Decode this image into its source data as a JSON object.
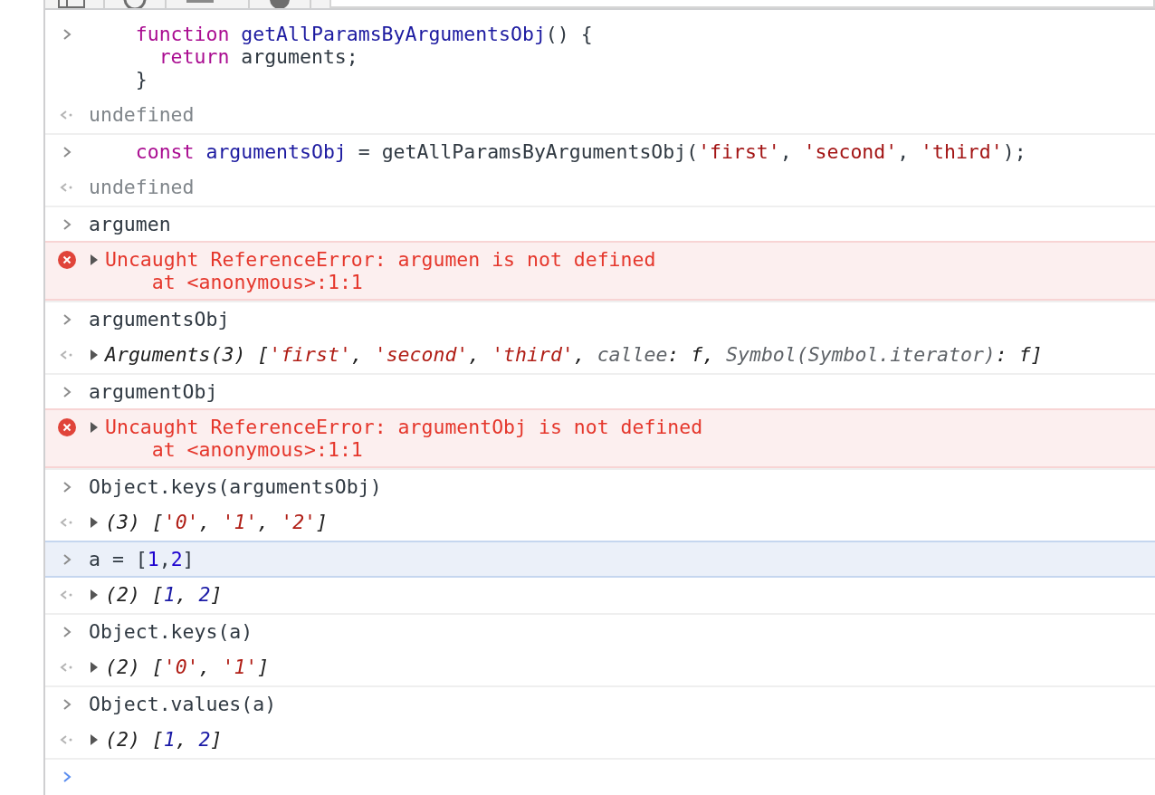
{
  "toolbar": {
    "filter_field": {
      "kind": "field"
    }
  },
  "groups": [
    {
      "messages": [
        {
          "kind": "input",
          "selected": false,
          "lines": [
            [
              {
                "kind": "keyword",
                "t": "    function "
              },
              {
                "kind": "name",
                "t": "getAllParamsByArgumentsObj"
              },
              {
                "kind": "plain",
                "t": "() {"
              }
            ],
            [
              {
                "kind": "keyword",
                "t": "      return "
              },
              {
                "kind": "plain",
                "t": "arguments;"
              }
            ],
            [
              {
                "kind": "plain",
                "t": "    }"
              }
            ]
          ]
        },
        {
          "kind": "output",
          "lines": [
            [
              {
                "kind": "muted",
                "t": "undefined"
              }
            ]
          ]
        }
      ]
    },
    {
      "messages": [
        {
          "kind": "input",
          "selected": false,
          "lines": [
            [
              {
                "kind": "keyword",
                "t": "    const "
              },
              {
                "kind": "name",
                "t": "argumentsObj"
              },
              {
                "kind": "plain",
                "t": " = getAllParamsByArgumentsObj("
              },
              {
                "kind": "string",
                "t": "'first'"
              },
              {
                "kind": "plain",
                "t": ", "
              },
              {
                "kind": "string",
                "t": "'second'"
              },
              {
                "kind": "plain",
                "t": ", "
              },
              {
                "kind": "string",
                "t": "'third'"
              },
              {
                "kind": "plain",
                "t": ");"
              }
            ]
          ]
        },
        {
          "kind": "output",
          "lines": [
            [
              {
                "kind": "muted",
                "t": "undefined"
              }
            ]
          ]
        }
      ]
    },
    {
      "messages": [
        {
          "kind": "input",
          "selected": false,
          "lines": [
            [
              {
                "kind": "plain",
                "t": "argumen"
              }
            ]
          ]
        },
        {
          "kind": "error",
          "expanded": false,
          "lines": [
            [
              {
                "kind": "error",
                "t": "Uncaught ReferenceError: argumen is not defined"
              }
            ],
            [
              {
                "kind": "error",
                "t": "    at <anonymous>:1:1"
              }
            ]
          ]
        }
      ]
    },
    {
      "messages": [
        {
          "kind": "input",
          "selected": false,
          "lines": [
            [
              {
                "kind": "plain",
                "t": "argumentsObj"
              }
            ]
          ]
        },
        {
          "kind": "output",
          "expanded": false,
          "lines": [
            [
              {
                "kind": "italic",
                "t": "Arguments(3) ["
              },
              {
                "kind": "istring",
                "t": "'first'"
              },
              {
                "kind": "italic",
                "t": ", "
              },
              {
                "kind": "istring",
                "t": "'second'"
              },
              {
                "kind": "italic",
                "t": ", "
              },
              {
                "kind": "istring",
                "t": "'third'"
              },
              {
                "kind": "italic",
                "t": ", "
              },
              {
                "kind": "iprop",
                "t": "callee"
              },
              {
                "kind": "italic",
                "t": ": f, "
              },
              {
                "kind": "iprop",
                "t": "Symbol(Symbol.iterator)"
              },
              {
                "kind": "italic",
                "t": ": f]"
              }
            ]
          ]
        }
      ]
    },
    {
      "messages": [
        {
          "kind": "input",
          "selected": false,
          "lines": [
            [
              {
                "kind": "plain",
                "t": "argumentObj"
              }
            ]
          ]
        },
        {
          "kind": "error",
          "expanded": false,
          "lines": [
            [
              {
                "kind": "error",
                "t": "Uncaught ReferenceError: argumentObj is not defined"
              }
            ],
            [
              {
                "kind": "error",
                "t": "    at <anonymous>:1:1"
              }
            ]
          ]
        }
      ]
    },
    {
      "messages": [
        {
          "kind": "input",
          "selected": false,
          "lines": [
            [
              {
                "kind": "plain",
                "t": "Object.keys(argumentsObj)"
              }
            ]
          ]
        },
        {
          "kind": "output",
          "expanded": false,
          "lines": [
            [
              {
                "kind": "italic",
                "t": "(3) ["
              },
              {
                "kind": "istring",
                "t": "'0'"
              },
              {
                "kind": "italic",
                "t": ", "
              },
              {
                "kind": "istring",
                "t": "'1'"
              },
              {
                "kind": "italic",
                "t": ", "
              },
              {
                "kind": "istring",
                "t": "'2'"
              },
              {
                "kind": "italic",
                "t": "]"
              }
            ]
          ]
        }
      ]
    },
    {
      "messages": [
        {
          "kind": "input",
          "selected": true,
          "lines": [
            [
              {
                "kind": "plain",
                "t": "a = ["
              },
              {
                "kind": "number",
                "t": "1"
              },
              {
                "kind": "plain",
                "t": ","
              },
              {
                "kind": "number",
                "t": "2"
              },
              {
                "kind": "plain",
                "t": "]"
              }
            ]
          ]
        },
        {
          "kind": "output",
          "expanded": false,
          "lines": [
            [
              {
                "kind": "italic",
                "t": "(2) ["
              },
              {
                "kind": "inumber",
                "t": "1"
              },
              {
                "kind": "italic",
                "t": ", "
              },
              {
                "kind": "inumber",
                "t": "2"
              },
              {
                "kind": "italic",
                "t": "]"
              }
            ]
          ]
        }
      ]
    },
    {
      "messages": [
        {
          "kind": "input",
          "selected": false,
          "lines": [
            [
              {
                "kind": "plain",
                "t": "Object.keys(a)"
              }
            ]
          ]
        },
        {
          "kind": "output",
          "expanded": false,
          "lines": [
            [
              {
                "kind": "italic",
                "t": "(2) ["
              },
              {
                "kind": "istring",
                "t": "'0'"
              },
              {
                "kind": "italic",
                "t": ", "
              },
              {
                "kind": "istring",
                "t": "'1'"
              },
              {
                "kind": "italic",
                "t": "]"
              }
            ]
          ]
        }
      ]
    },
    {
      "messages": [
        {
          "kind": "input",
          "selected": false,
          "lines": [
            [
              {
                "kind": "plain",
                "t": "Object.values(a)"
              }
            ]
          ]
        },
        {
          "kind": "output",
          "expanded": false,
          "lines": [
            [
              {
                "kind": "italic",
                "t": "(2) ["
              },
              {
                "kind": "inumber",
                "t": "1"
              },
              {
                "kind": "italic",
                "t": ", "
              },
              {
                "kind": "inumber",
                "t": "2"
              },
              {
                "kind": "italic",
                "t": "]"
              }
            ]
          ]
        }
      ]
    }
  ],
  "prompt": {
    "kind": "prompt"
  }
}
